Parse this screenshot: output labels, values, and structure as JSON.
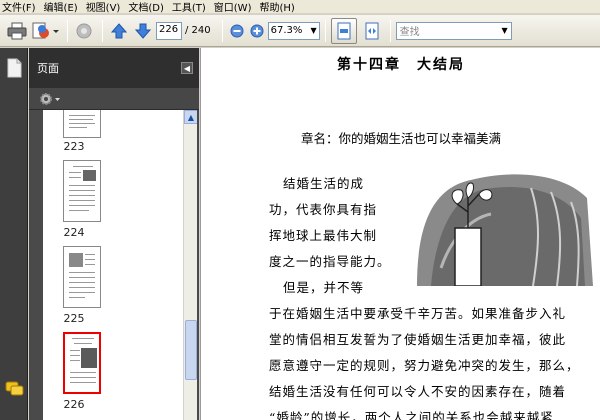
{
  "menu": [
    {
      "label": "文件(F)"
    },
    {
      "label": "编辑(E)"
    },
    {
      "label": "视图(V)"
    },
    {
      "label": "文档(D)"
    },
    {
      "label": "工具(T)"
    },
    {
      "label": "窗口(W)"
    },
    {
      "label": "帮助(H)"
    }
  ],
  "toolbar": {
    "current_page": "226",
    "total_pages": "/ 240",
    "zoom": "67.3%",
    "search_placeholder": "查找"
  },
  "panel": {
    "title": "页面",
    "thumbnails": [
      {
        "label": "223"
      },
      {
        "label": "224"
      },
      {
        "label": "225"
      },
      {
        "label": "226",
        "selected": true
      }
    ]
  },
  "document": {
    "chapter_title": "第十四章　大结局",
    "section_title": "章名：你的婚姻生活也可以幸福美满",
    "lines": [
      "结婚生活的成",
      "功，代表你具有指",
      "挥地球上最伟大制",
      "度之一的指导能力。",
      "但是，并不等",
      "于在婚姻生活中要承受千辛万苦。如果准备步入礼",
      "堂的情侣相互发誓为了使婚姻生活更加幸福，彼此",
      "愿意遵守一定的规则，努力避免冲突的发生，那么，",
      "结婚生活没有任何可以令人不安的因素存在，随着",
      "“婚龄”的增长，两个人之间的关系也会越来越紧"
    ]
  },
  "colors": {
    "accent_blue": "#2a6fd6",
    "selection_red": "#e00000"
  }
}
